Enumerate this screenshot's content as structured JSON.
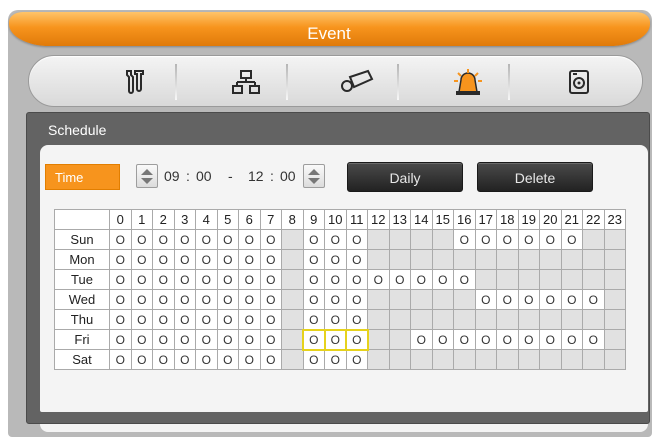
{
  "window": {
    "title": "Event"
  },
  "nav": [
    {
      "icon": "tools-icon"
    },
    {
      "icon": "network-icon"
    },
    {
      "icon": "camera-icon"
    },
    {
      "icon": "alarm-icon",
      "active": true
    },
    {
      "icon": "storage-icon"
    }
  ],
  "schedule": {
    "title": "Schedule",
    "time_label": "Time",
    "start_hour": "09",
    "start_minute": "00",
    "separator": ":",
    "dash": "-",
    "end_hour": "12",
    "end_minute": "00",
    "daily_label": "Daily",
    "delete_label": "Delete",
    "mark": "O",
    "hours": [
      "0",
      "1",
      "2",
      "3",
      "4",
      "5",
      "6",
      "7",
      "8",
      "9",
      "10",
      "11",
      "12",
      "13",
      "14",
      "15",
      "16",
      "17",
      "18",
      "19",
      "20",
      "21",
      "22",
      "23"
    ],
    "days": [
      {
        "name": "Sun",
        "marked": [
          0,
          1,
          2,
          3,
          4,
          5,
          6,
          7,
          9,
          10,
          11,
          16,
          17,
          18,
          19,
          20,
          21
        ]
      },
      {
        "name": "Mon",
        "marked": [
          0,
          1,
          2,
          3,
          4,
          5,
          6,
          7,
          9,
          10,
          11
        ]
      },
      {
        "name": "Tue",
        "marked": [
          0,
          1,
          2,
          3,
          4,
          5,
          6,
          7,
          9,
          10,
          11,
          12,
          13,
          14,
          15,
          16
        ]
      },
      {
        "name": "Wed",
        "marked": [
          0,
          1,
          2,
          3,
          4,
          5,
          6,
          7,
          9,
          10,
          11,
          17,
          18,
          19,
          20,
          21,
          22
        ]
      },
      {
        "name": "Thu",
        "marked": [
          0,
          1,
          2,
          3,
          4,
          5,
          6,
          7,
          9,
          10,
          11
        ]
      },
      {
        "name": "Fri",
        "marked": [
          0,
          1,
          2,
          3,
          4,
          5,
          6,
          7,
          9,
          10,
          11,
          14,
          15,
          16,
          17,
          18,
          19,
          20,
          21,
          22
        ],
        "selected": [
          9,
          10,
          11
        ]
      },
      {
        "name": "Sat",
        "marked": [
          0,
          1,
          2,
          3,
          4,
          5,
          6,
          7,
          9,
          10,
          11
        ]
      }
    ]
  }
}
